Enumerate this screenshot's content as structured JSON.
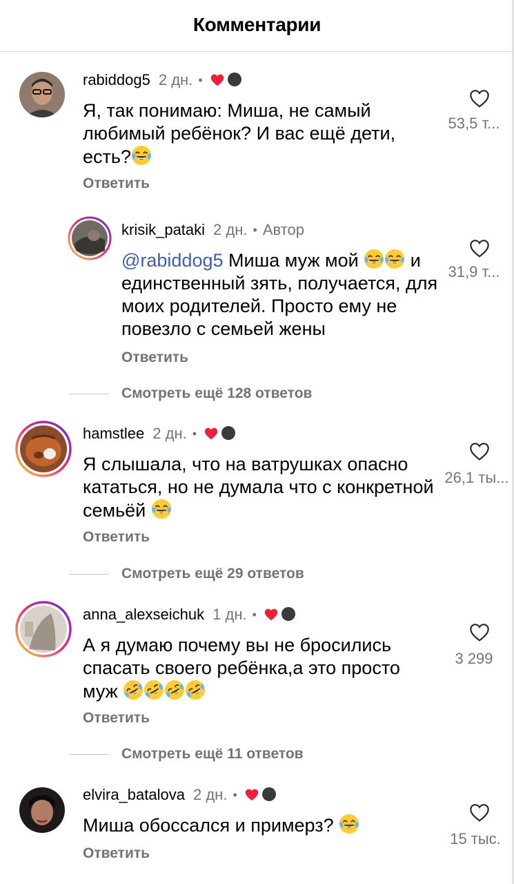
{
  "header": {
    "title": "Комментарии"
  },
  "comments": [
    {
      "username": "rabiddog5",
      "time": "2 дн.",
      "text": "Я, так понимаю: Миша, не самый любимый ребёнок? И вас ещё дети, есть?",
      "reply_label": "Ответить",
      "likes": "53,5 т...",
      "view_more": ""
    },
    {
      "username": "krisik_pataki",
      "time": "2 дн.",
      "author_badge": "Автор",
      "mention": "@rabiddog5",
      "text_a": "Миша муж мой",
      "text_b": "и единственный зять, получается, для моих родителей. Просто ему не повезло с семьей жены",
      "reply_label": "Ответить",
      "likes": "31,9 т...",
      "view_more": "Смотреть ещё 128 ответов"
    },
    {
      "username": "hamstlee",
      "time": "2 дн.",
      "text": "Я слышала, что на ватрушках опасно кататься, но не думала что с конкретной семьёй",
      "reply_label": "Ответить",
      "likes": "26,1 ты...",
      "view_more": "Смотреть ещё 29 ответов"
    },
    {
      "username": "anna_alexseichuk",
      "time": "1 дн.",
      "text": "А я думаю почему вы не бросились спасать своего ребёнка,а это просто муж",
      "reply_label": "Ответить",
      "likes": "3 299",
      "view_more": "Смотреть ещё 11 ответов"
    },
    {
      "username": "elvira_batalova",
      "time": "2 дн.",
      "text": "Миша обоссался и примерз?",
      "reply_label": "Ответить",
      "likes": "15 тыс.",
      "view_more": ""
    }
  ],
  "separator": "•",
  "colors": {
    "heart": "#ed1f3a",
    "muted": "#737373",
    "mention": "#3f5ea8",
    "story_ring_start": "#f9ce34",
    "story_ring_end": "#c13584"
  },
  "icons": [
    "heart-outline-icon",
    "red-heart-icon",
    "joy-emoji",
    "rofl-emoji"
  ]
}
